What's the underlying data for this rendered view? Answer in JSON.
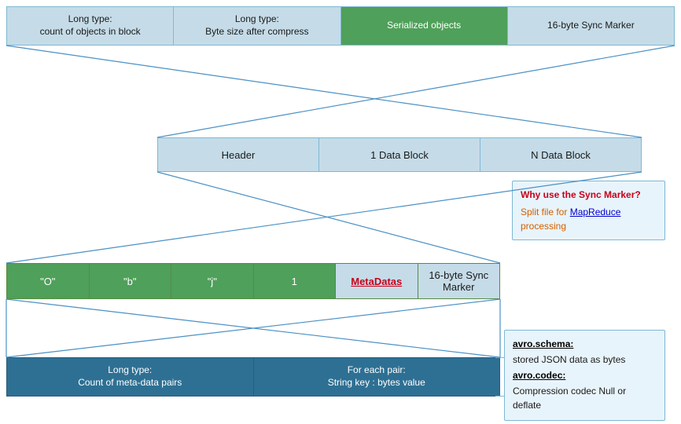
{
  "topBar": {
    "cells": [
      {
        "id": "long-type-count",
        "line1": "Long type:",
        "line2": "count of objects in block"
      },
      {
        "id": "long-type-byte",
        "line1": "Long type:",
        "line2": "Byte size after compress"
      },
      {
        "id": "serialized",
        "line1": "Serialized objects",
        "line2": ""
      },
      {
        "id": "sync-marker-16",
        "line1": "16-byte Sync Marker",
        "line2": ""
      }
    ]
  },
  "middleBar": {
    "cells": [
      {
        "id": "header",
        "label": "Header"
      },
      {
        "id": "data-block-1",
        "label": "1 Data Block"
      },
      {
        "id": "data-block-n",
        "label": "N Data Block"
      }
    ]
  },
  "bottomBar": {
    "cells": [
      {
        "id": "quote-o",
        "label": "\"O\""
      },
      {
        "id": "quote-b",
        "label": "\"b\""
      },
      {
        "id": "quote-j",
        "label": "\"j\""
      },
      {
        "id": "num-1",
        "label": "1"
      },
      {
        "id": "metadata",
        "label": "MetaDatas",
        "special": "metadata"
      },
      {
        "id": "sync-16",
        "label": "16-byte Sync Marker",
        "special": "sync"
      }
    ]
  },
  "vbottomBar": {
    "cells": [
      {
        "id": "long-type-meta",
        "line1": "Long type:",
        "line2": "Count of meta-data pairs"
      },
      {
        "id": "for-each-pair",
        "line1": "For each pair:",
        "line2": "String key : bytes value"
      }
    ]
  },
  "syncInfoBox": {
    "title": "Why use the Sync Marker?",
    "body": "Split file for ",
    "link": "MapReduce",
    "body2": " processing"
  },
  "avroInfoBox": {
    "schemaLabel": "avro.schema:",
    "schemaDesc": "stored JSON data as bytes",
    "codecLabel": "avro.codec:",
    "codecDesc": "Compression codec Null or deflate"
  },
  "lines": {
    "color": "#4a90c4"
  }
}
